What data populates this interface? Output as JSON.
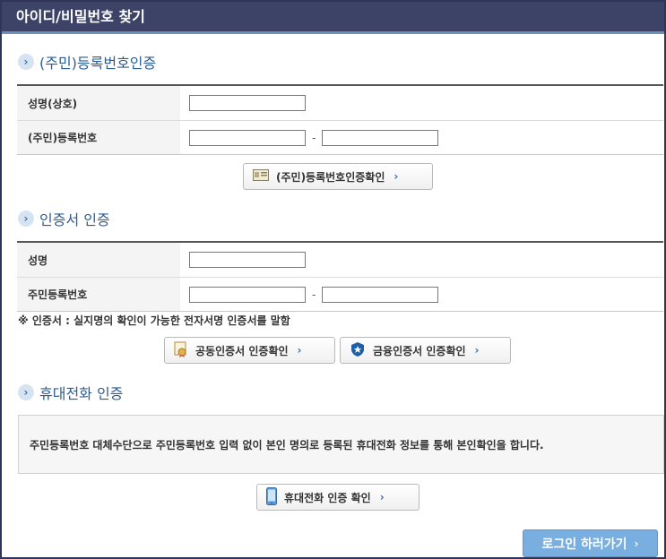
{
  "window": {
    "title": "아이디/비밀번호 찾기"
  },
  "sections": {
    "reg": {
      "title": "(주민)등록번호인증",
      "rows": [
        {
          "label": "성명(상호)"
        },
        {
          "label": "(주민)등록번호"
        }
      ],
      "button": "(주민)등록번호인증확인"
    },
    "cert": {
      "title": "인증서 인증",
      "rows": [
        {
          "label": "성명"
        },
        {
          "label": "주민등록번호"
        }
      ],
      "note": "※ 인증서 : 실지명의 확인이 가능한 전자서명 인증서를 말함",
      "button_joint": "공동인증서 인증확인",
      "button_finance": "금융인증서 인증확인"
    },
    "phone": {
      "title": "휴대전화 인증",
      "info": "주민등록번호 대체수단으로 주민등록번호 입력 없이 본인 명의로 등록된 휴대전화 정보를 통해 본인확인을 합니다.",
      "button": "휴대전화 인증 확인"
    }
  },
  "footer": {
    "login_button": "로그인 하러가기"
  },
  "icons": {
    "section": "chevron-right-icon",
    "reg_button": "id-card-icon",
    "joint_cert": "certificate-icon",
    "finance_cert": "shield-star-icon",
    "phone": "mobile-phone-icon"
  },
  "colors": {
    "titlebar": "#3c4367",
    "section_title": "#2d5e93",
    "login_button": "#78aee0"
  }
}
